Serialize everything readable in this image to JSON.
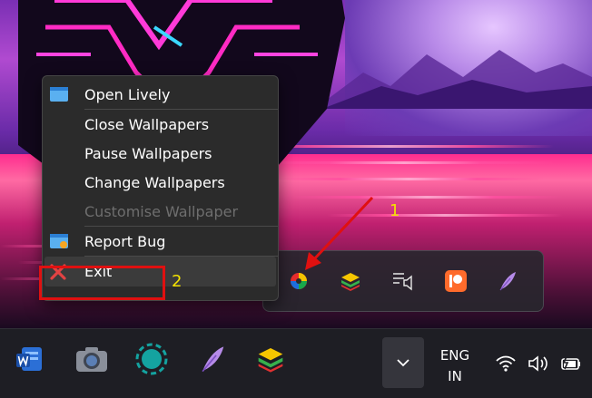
{
  "context_menu": {
    "items": [
      {
        "label": "Open Lively",
        "icon": "lively-window-icon",
        "enabled": true
      },
      {
        "label": "Close Wallpapers",
        "enabled": true
      },
      {
        "label": "Pause Wallpapers",
        "enabled": true
      },
      {
        "label": "Change Wallpapers",
        "enabled": true
      },
      {
        "label": "Customise Wallpaper",
        "enabled": false
      },
      {
        "label": "Report Bug",
        "icon": "bug-report-icon",
        "enabled": true
      },
      {
        "label": "Exit",
        "icon": "red-x-icon",
        "enabled": true
      }
    ]
  },
  "annotations": {
    "step1": "1",
    "step2": "2",
    "color": "#f4e200",
    "arrow_color": "#e01010"
  },
  "tray_flyout": {
    "icons": [
      "lively-wallpaper-tray-icon",
      "bluestacks-icon",
      "media-cast-icon",
      "patreon-icon",
      "feather-icon"
    ]
  },
  "taskbar": {
    "apps": [
      "word-icon",
      "camera-icon",
      "circle-app-icon",
      "feather-app-icon",
      "bluestacks-app-icon"
    ],
    "language": {
      "line1": "ENG",
      "line2": "IN"
    },
    "system_icons": [
      "wifi-icon",
      "volume-icon",
      "battery-icon"
    ]
  }
}
